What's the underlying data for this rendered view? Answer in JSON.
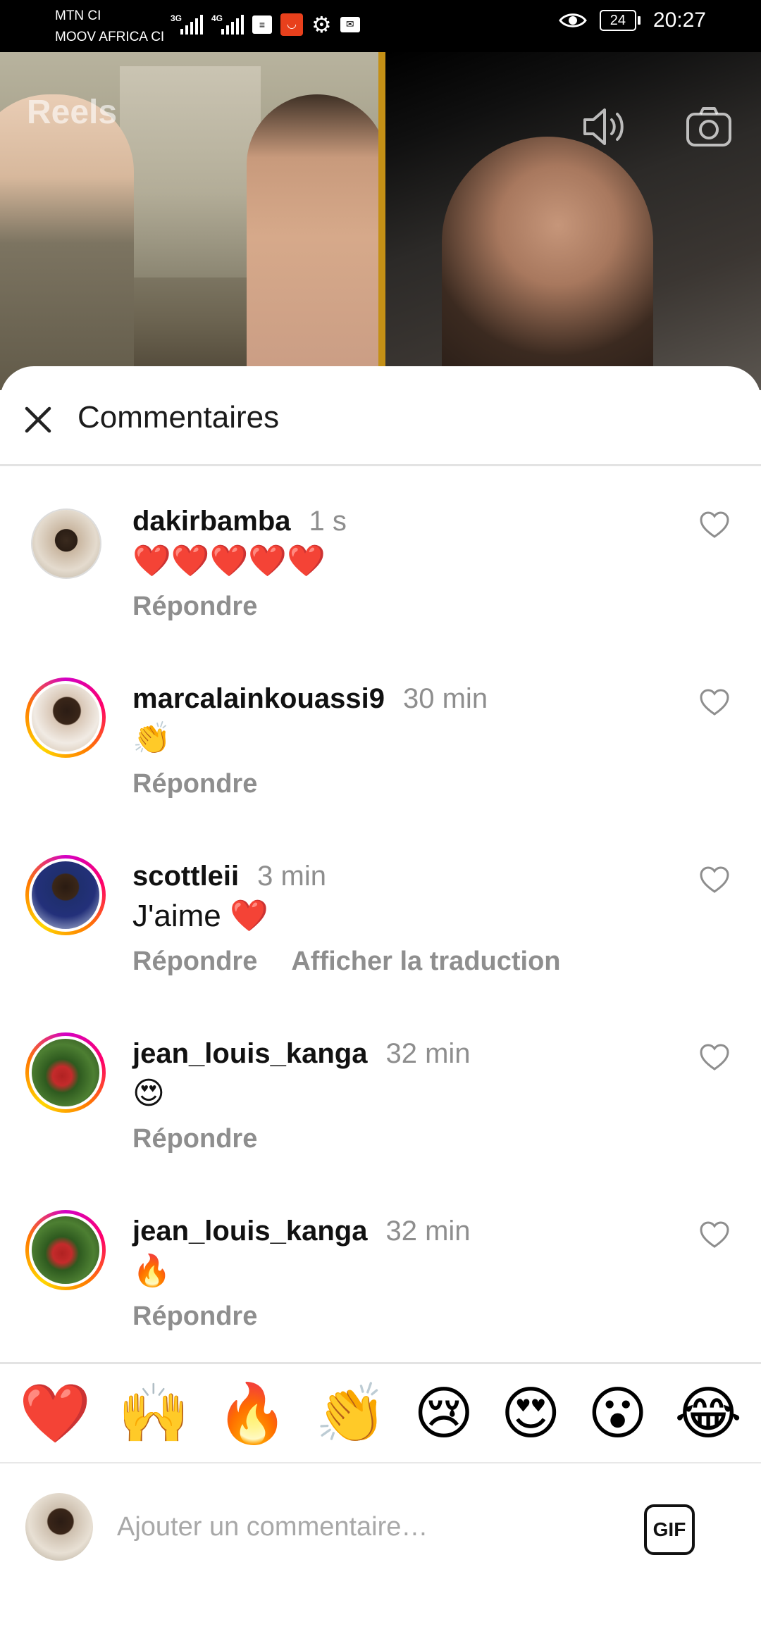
{
  "status_bar": {
    "carrier1": "MTN CI",
    "carrier2": "MOOV AFRICA CI",
    "net1": "3G",
    "net2": "4G",
    "battery": "24",
    "time": "20:27",
    "icons": [
      "signal-icon",
      "signal-icon",
      "message-icon",
      "shop-icon",
      "gear-icon",
      "mail-icon",
      "eye-icon",
      "battery-icon"
    ]
  },
  "video": {
    "title": "Reels",
    "icons": [
      "volume-icon",
      "camera-icon"
    ]
  },
  "comments_sheet": {
    "title": "Commentaires",
    "comments": [
      {
        "user": "dakirbamba",
        "time": "1 s",
        "text": "❤️❤️❤️❤️❤️",
        "reply": "Répondre",
        "translate": "",
        "ring": false
      },
      {
        "user": "marcalainkouassi9",
        "time": "30 min",
        "text": "👏",
        "reply": "Répondre",
        "translate": "",
        "ring": true
      },
      {
        "user": "scottleii",
        "time": "3 min",
        "text": "J'aime ❤️",
        "reply": "Répondre",
        "translate": "Afficher la traduction",
        "ring": true
      },
      {
        "user": "jean_louis_kanga",
        "time": "32 min",
        "text": "😍",
        "reply": "Répondre",
        "translate": "",
        "ring": true
      },
      {
        "user": "jean_louis_kanga",
        "time": "32 min",
        "text": "🔥",
        "reply": "Répondre",
        "translate": "",
        "ring": true
      }
    ],
    "quick_emojis": [
      "❤️",
      "🙌",
      "🔥",
      "👏",
      "😢",
      "😍",
      "😮",
      "😂"
    ],
    "input": {
      "placeholder": "Ajouter un commentaire…",
      "value": "",
      "gif_label": "GIF"
    }
  }
}
